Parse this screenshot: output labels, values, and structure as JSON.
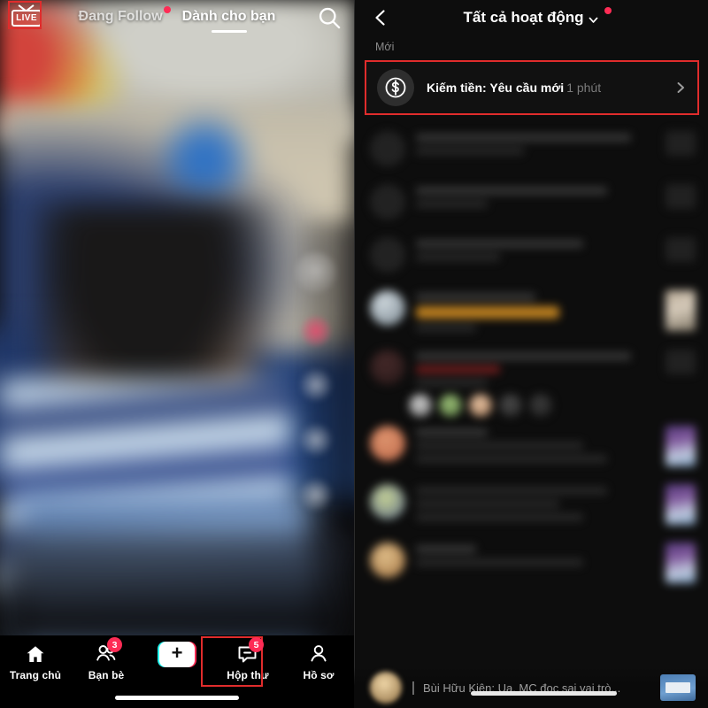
{
  "feed": {
    "live_label": "LIVE",
    "tabs": [
      {
        "label": "Đang Follow",
        "active": false,
        "has_dot": true
      },
      {
        "label": "Dành cho bạn",
        "active": true,
        "has_dot": false
      }
    ],
    "search_icon": "search-icon",
    "bottom_nav": [
      {
        "label": "Trang chủ",
        "icon": "home-icon",
        "badge": ""
      },
      {
        "label": "Bạn bè",
        "icon": "friends-icon",
        "badge": "3"
      },
      {
        "label": "",
        "icon": "create-plus-icon",
        "badge": ""
      },
      {
        "label": "Hộp thư",
        "icon": "inbox-icon",
        "badge": "5"
      },
      {
        "label": "Hồ sơ",
        "icon": "profile-icon",
        "badge": ""
      }
    ]
  },
  "inbox": {
    "back_icon": "back-chevron-icon",
    "title": "Tất cả hoạt động",
    "title_chevron": "chevron-down-icon",
    "section_label": "Mới",
    "money_row": {
      "icon": "dollar-circle-icon",
      "label": "Kiếm tiền: Yêu cầu mới",
      "time": "1 phút",
      "chevron": "chevron-right-icon"
    },
    "bottom_message": "Bùi Hữu Kiên: Ua. MC đọc sai vai trò..."
  },
  "colors": {
    "accent_pink": "#fe2c55",
    "accent_cyan": "#25f4ee",
    "highlight_red": "#e02c2c",
    "background": "#000000",
    "panel_background": "#0d0d0d",
    "muted_text": "#8a8a8a"
  }
}
